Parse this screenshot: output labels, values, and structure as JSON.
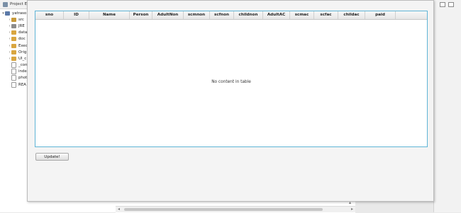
{
  "ide": {
    "view_title": "Project Exp",
    "tree": [
      {
        "label": "yatraso",
        "icon": "project-icon",
        "indent": 0,
        "twisty": "▾"
      },
      {
        "label": "src",
        "icon": "package-folder-icon",
        "indent": 1,
        "twisty": "›"
      },
      {
        "label": "JRE",
        "icon": "library-icon",
        "indent": 1,
        "twisty": "›"
      },
      {
        "label": "data",
        "icon": "folder-icon",
        "indent": 1,
        "twisty": "›"
      },
      {
        "label": "doc",
        "icon": "folder-icon",
        "indent": 1,
        "twisty": "›"
      },
      {
        "label": "Exec",
        "icon": "folder-icon",
        "indent": 1,
        "twisty": "›"
      },
      {
        "label": "Orig",
        "icon": "folder-icon",
        "indent": 1,
        "twisty": "›"
      },
      {
        "label": "UI_c",
        "icon": "folder-icon",
        "indent": 1,
        "twisty": "›"
      },
      {
        "label": "_con",
        "icon": "file-icon",
        "indent": 1,
        "twisty": ""
      },
      {
        "label": "inde",
        "icon": "file-icon",
        "indent": 1,
        "twisty": ""
      },
      {
        "label": "phot",
        "icon": "file-icon",
        "indent": 1,
        "twisty": ""
      },
      {
        "label": "REA",
        "icon": "file-icon",
        "indent": 1,
        "twisty": ""
      }
    ]
  },
  "dialog": {
    "table": {
      "columns": [
        "sno",
        "ID",
        "Name",
        "Person",
        "AdultNon",
        "scmnon",
        "scfnon",
        "childnon",
        "AdultAC",
        "scmac",
        "scfac",
        "childac",
        "paid"
      ],
      "placeholder": "No content in table"
    },
    "update_button_label": "Update!"
  }
}
